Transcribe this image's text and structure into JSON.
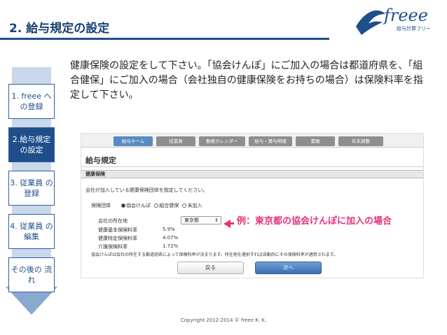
{
  "slide": {
    "title": "2. 給与規定の設定",
    "copyright": "Copyright 2012-2014 © freee K. K."
  },
  "logo": {
    "word": "freee",
    "subtitle": "給与計算フリー"
  },
  "intro": {
    "text": "健康保険の設定をして下さい。「協会けんぽ」にご加入の場合は都道府県を、「組合健保」にご加入の場合（会社独自の健康保険をお持ちの場合）は保険料率を指定して下さい。"
  },
  "steps": [
    {
      "label": "1. freee への登録",
      "active": false
    },
    {
      "label": "2.給与規定 の設定",
      "active": true
    },
    {
      "label": "3. 従業員 の登録",
      "active": false
    },
    {
      "label": "4. 従業員 の編集",
      "active": false
    },
    {
      "label": "その後の 流れ",
      "active": false
    }
  ],
  "screenshot": {
    "tabs": [
      "給与ホーム",
      "従業員",
      "勤務カレンダー",
      "給与・賞与明細",
      "書類",
      "年末調整"
    ],
    "active_tab": "給与ホーム",
    "page_title": "給与規定",
    "section_header": "健康保険",
    "section_desc": "会社が加入している健康保険団体を指定してください。",
    "insurer_label": "保険団体",
    "insurer_options": [
      "協会けんぽ",
      "組合健保",
      "未加入"
    ],
    "insurer_selected": "協会けんぽ",
    "prefecture_label": "会社の所在地",
    "prefecture_value": "東京都",
    "rates": [
      {
        "label": "健康基本保険料率",
        "value": "5.9%"
      },
      {
        "label": "健康特定保険料率",
        "value": "4.07%"
      },
      {
        "label": "介護保険料率",
        "value": "1.72%"
      }
    ],
    "note": "協会けんぽは会社の所在する都道府県によって保険料率が決まります。所在地を選択すれば自動的にその保険料率が適用されます。",
    "back_button": "戻る",
    "next_button": "次へ",
    "annotation": "例：東京都の協会けんぽに加入の場合"
  },
  "colors": {
    "brand": "#1f4f8b",
    "annotation": "#e4337a",
    "arrow": "#c9d8ea"
  }
}
